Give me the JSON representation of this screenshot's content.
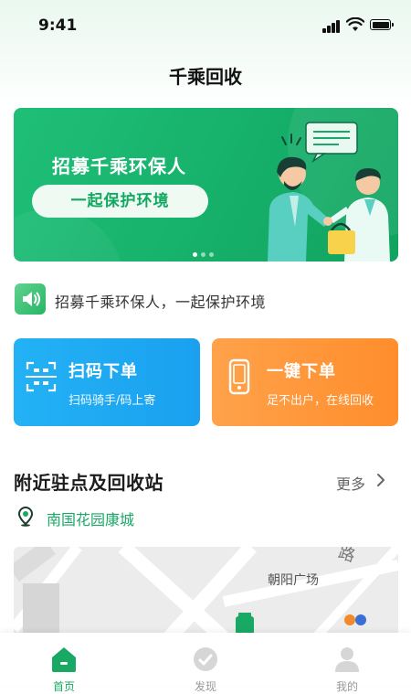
{
  "status_bar": {
    "time": "9:41"
  },
  "header": {
    "title": "千乘回收"
  },
  "banner": {
    "headline": "招募千乘环保人",
    "button_label": "一起保护环境",
    "page_count": 3,
    "active_page": 1
  },
  "notice": {
    "text": "招募千乘环保人，一起保护环境"
  },
  "actions": [
    {
      "title": "扫码下单",
      "subtitle": "扫码骑手/码上寄",
      "icon": "qr-scan-icon",
      "color": "#1fa9f3"
    },
    {
      "title": "一键下单",
      "subtitle": "足不出户，在线回收",
      "icon": "phone-icon",
      "color": "#ff9535"
    }
  ],
  "nearby": {
    "title": "附近驻点及回收站",
    "more_label": "更多",
    "location": "南国花园康城",
    "map_labels": [
      "朝阳广场",
      "路"
    ]
  },
  "tabs": [
    {
      "label": "首页",
      "icon": "home-icon",
      "active": true
    },
    {
      "label": "发现",
      "icon": "discover-icon",
      "active": false
    },
    {
      "label": "我的",
      "icon": "user-icon",
      "active": false
    }
  ],
  "colors": {
    "brand_green": "#19a964",
    "scan_blue": "#1fa9f3",
    "order_orange": "#ff9535"
  }
}
